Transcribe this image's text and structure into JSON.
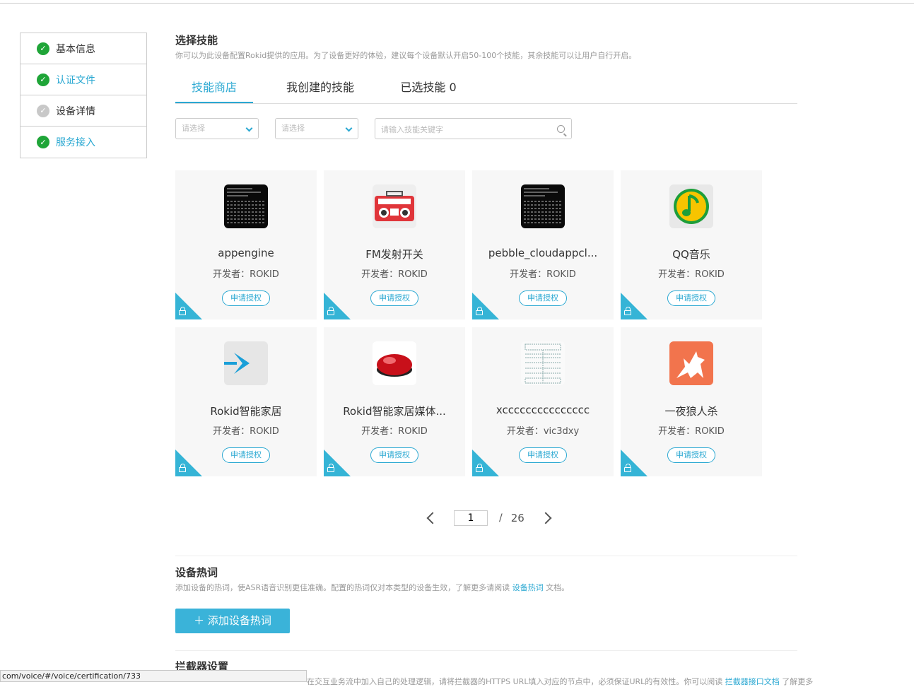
{
  "sidebar": {
    "steps": [
      {
        "label": "基本信息",
        "state": "done",
        "active": false
      },
      {
        "label": "认证文件",
        "state": "done",
        "active": true
      },
      {
        "label": "设备详情",
        "state": "pending",
        "active": false
      },
      {
        "label": "服务接入",
        "state": "done",
        "active": true
      }
    ]
  },
  "skills": {
    "title": "选择技能",
    "description": "你可以为此设备配置Rokid提供的应用。为了设备更好的体验，建议每个设备默认开启50-100个技能，其余技能可以让用户自行开启。",
    "tabs": [
      "技能商店",
      "我创建的技能",
      "已选技能 0"
    ],
    "active_tab": 0,
    "filter1_placeholder": "请选择",
    "filter2_placeholder": "请选择",
    "search_placeholder": "请输入技能关键字",
    "cards": [
      {
        "name": "appengine",
        "developer": "开发者：ROKID",
        "icon": "terminal-icon",
        "action": "申请授权"
      },
      {
        "name": "FM发射开关",
        "developer": "开发者：ROKID",
        "icon": "radio-icon",
        "action": "申请授权"
      },
      {
        "name": "pebble_cloudappcl...",
        "developer": "开发者：ROKID",
        "icon": "terminal-icon",
        "action": "申请授权"
      },
      {
        "name": "QQ音乐",
        "developer": "开发者：ROKID",
        "icon": "qq-music-icon",
        "action": "申请授权"
      },
      {
        "name": "Rokid智能家居",
        "developer": "开发者：ROKID",
        "icon": "arrow-icon",
        "action": "申请授权"
      },
      {
        "name": "Rokid智能家居媒体...",
        "developer": "开发者：ROKID",
        "icon": "red-speaker-icon",
        "action": "申请授权"
      },
      {
        "name": "xccccccccccccccc",
        "developer": "开发者：vic3dxy",
        "icon": "document-icon",
        "action": "申请授权"
      },
      {
        "name": "一夜狼人杀",
        "developer": "开发者：ROKID",
        "icon": "wolf-icon",
        "action": "申请授权"
      }
    ],
    "pagination": {
      "current": "1",
      "separator": "/",
      "total": "26"
    }
  },
  "hotwords": {
    "title": "设备热词",
    "description_before": "添加设备的热词，使ASR语音识别更佳准确。配置的热词仅对本类型的设备生效，了解更多请阅读 ",
    "link": "设备热词",
    "description_after": " 文档。",
    "add_button": "＋  添加设备热词"
  },
  "interceptor": {
    "title": "拦截器设置",
    "description_cut": "在交互业务流中加入自己的处理逻辑，请将拦截器的HTTPS URL填入对应的节点中，必须保证URL的有效性。你可以阅读",
    "link": "拦截器接口文档",
    "after": "了解更多"
  },
  "status_bar": {
    "url": "com/voice/#/voice/certification/733"
  },
  "colors": {
    "accent": "#2aa8d2",
    "done": "#1fa538",
    "pending": "#c8c8c8",
    "corner": "#35b4d6"
  }
}
